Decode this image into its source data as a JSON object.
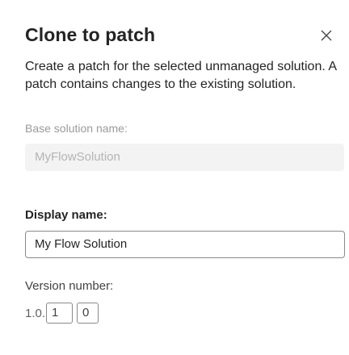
{
  "dialog": {
    "title": "Clone to patch",
    "close_icon": "close-icon",
    "description": "Create a patch for the selected unmanaged solution. A patch contains changes to the existing solution."
  },
  "base_solution": {
    "label": "Base solution name:",
    "value": "MyFlowSolution"
  },
  "display_name": {
    "label": "Display name:",
    "value": "My Flow Solution"
  },
  "version": {
    "label": "Version number:",
    "prefix": "1.0.",
    "major": "1",
    "minor": "0"
  }
}
